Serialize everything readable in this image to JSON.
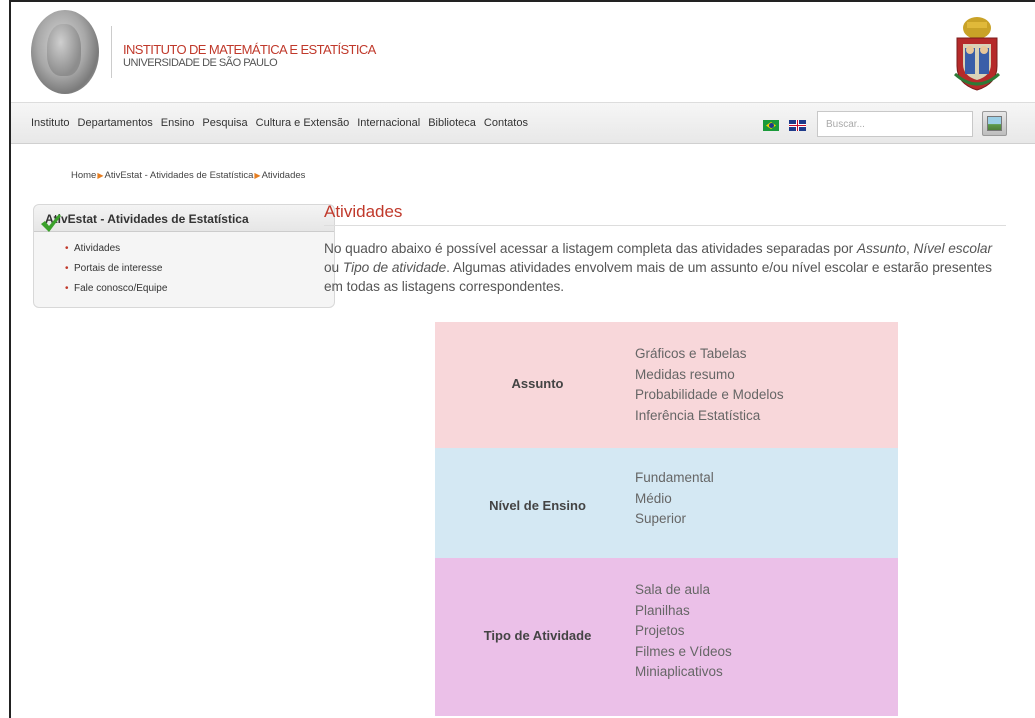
{
  "header": {
    "institute": "INSTITUTO DE MATEMÁTICA E ESTATÍSTICA",
    "university": "UNIVERSIDADE DE SÃO PAULO"
  },
  "nav": {
    "items": [
      "Instituto",
      "Departamentos",
      "Ensino",
      "Pesquisa",
      "Cultura e Extensão",
      "Internacional",
      "Biblioteca",
      "Contatos"
    ],
    "search_placeholder": "Buscar..."
  },
  "breadcrumb": [
    "Home",
    "AtivEstat - Atividades de Estatística",
    "Atividades"
  ],
  "sidebar": {
    "title": "AtivEstat - Atividades de Estatística",
    "items": [
      "Atividades",
      "Portais de interesse",
      "Fale conosco/Equipe"
    ]
  },
  "main": {
    "title": "Atividades",
    "intro_1": "No quadro abaixo é possível acessar a listagem completa das atividades separadas por ",
    "intro_assunto": "Assunto",
    "intro_2": ", ",
    "intro_nivel": "Nível escolar",
    "intro_3": " ou ",
    "intro_tipo": "Tipo de atividade",
    "intro_4": ". Algumas atividades envolvem mais de um assunto e/ou nível escolar e estarão presentes em todas as listagens correspondentes."
  },
  "table": {
    "rows": [
      {
        "label": "Assunto",
        "color": "#f8d7da",
        "values": [
          "Gráficos e Tabelas",
          "Medidas resumo",
          "Probabilidade e Modelos",
          "Inferência Estatística"
        ]
      },
      {
        "label": "Nível de Ensino",
        "color": "#d4e8f3",
        "values": [
          "Fundamental",
          "Médio",
          "Superior"
        ]
      },
      {
        "label": "Tipo de Atividade",
        "color": "#ebc0e8",
        "values": [
          "Sala de aula",
          "Planilhas",
          "Projetos",
          "Filmes e Vídeos",
          "Miniaplicativos"
        ]
      }
    ]
  },
  "colors": {
    "accent": "#c0392b",
    "breadcrumb_arrow": "#e67e22",
    "checkmark": "#3aa02a"
  }
}
